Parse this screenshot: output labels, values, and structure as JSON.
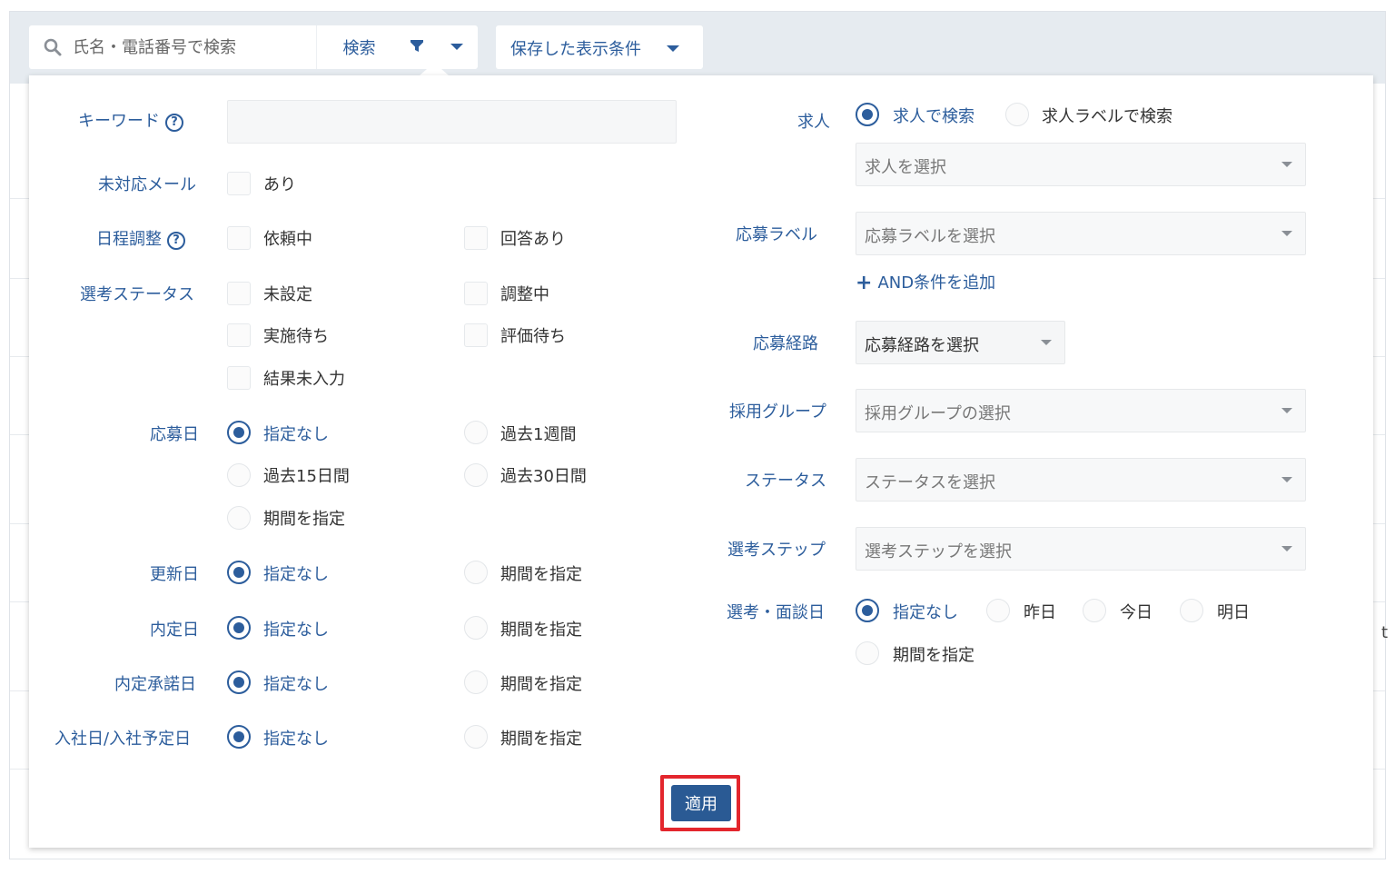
{
  "search": {
    "placeholder": "氏名・電話番号で検索",
    "button_label": "検索"
  },
  "toolbar": {
    "saved_conditions_label": "保存した表示条件"
  },
  "filter": {
    "keyword": {
      "label": "キーワード",
      "value": ""
    },
    "unreplied_mail": {
      "label": "未対応メール",
      "options": [
        "あり"
      ]
    },
    "schedule": {
      "label": "日程調整",
      "options": [
        "依頼中",
        "回答あり"
      ]
    },
    "selection_status": {
      "label": "選考ステータス",
      "options": [
        "未設定",
        "調整中",
        "実施待ち",
        "評価待ち",
        "結果未入力"
      ]
    },
    "applied_date": {
      "label": "応募日",
      "options": [
        "指定なし",
        "過去1週間",
        "過去15日間",
        "過去30日間",
        "期間を指定"
      ],
      "selected": "指定なし"
    },
    "updated_date": {
      "label": "更新日",
      "options": [
        "指定なし",
        "期間を指定"
      ],
      "selected": "指定なし"
    },
    "offer_date": {
      "label": "内定日",
      "options": [
        "指定なし",
        "期間を指定"
      ],
      "selected": "指定なし"
    },
    "offer_accept_date": {
      "label": "内定承諾日",
      "options": [
        "指定なし",
        "期間を指定"
      ],
      "selected": "指定なし"
    },
    "join_date": {
      "label": "入社日/入社予定日",
      "options": [
        "指定なし",
        "期間を指定"
      ],
      "selected": "指定なし"
    },
    "job": {
      "label": "求人",
      "options": [
        "求人で検索",
        "求人ラベルで検索"
      ],
      "selected": "求人で検索",
      "select_placeholder": "求人を選択"
    },
    "application_label": {
      "label": "応募ラベル",
      "select_placeholder": "応募ラベルを選択",
      "add_condition": "AND条件を追加"
    },
    "route": {
      "label": "応募経路",
      "select_placeholder": "応募経路を選択"
    },
    "group": {
      "label": "採用グループ",
      "select_placeholder": "採用グループの選択"
    },
    "status": {
      "label": "ステータス",
      "select_placeholder": "ステータスを選択"
    },
    "step": {
      "label": "選考ステップ",
      "select_placeholder": "選考ステップを選択"
    },
    "interview_date": {
      "label": "選考・面談日",
      "options": [
        "指定なし",
        "昨日",
        "今日",
        "明日",
        "期間を指定"
      ],
      "selected": "指定なし"
    },
    "apply_label": "適用"
  },
  "background": {
    "stray_text": "t"
  },
  "colors": {
    "accent": "#2c5d9c",
    "apply_button": "#2a5a94",
    "highlight": "#e3262d",
    "toolbar_bg": "#e6ebf0"
  },
  "icons": {
    "search": "search-icon",
    "filter": "filter-icon",
    "help": "help-icon",
    "plus": "plus-icon",
    "caret": "chevron-down-icon"
  }
}
